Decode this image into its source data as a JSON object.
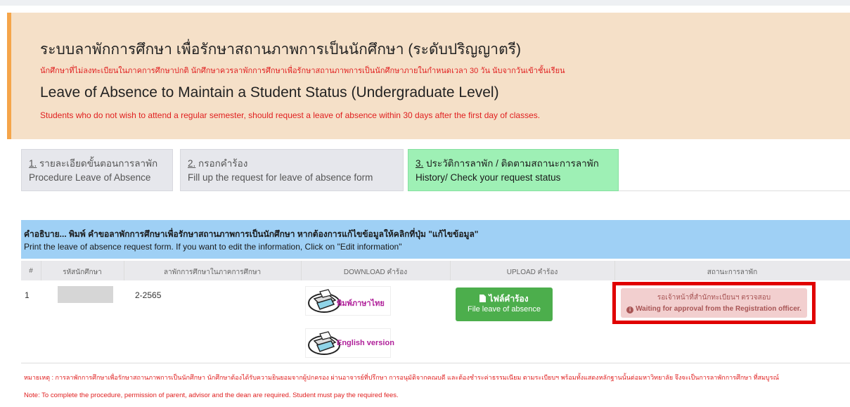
{
  "header": {
    "title_th": "ระบบลาพักการศึกษา เพื่อรักษาสถานภาพการเป็นนักศึกษา (ระดับปริญญาตรี)",
    "note_th": "นักศึกษาที่ไม่ลงทะเบียนในภาคการศึกษาปกติ นักศึกษาควรลาพักการศึกษาเพื่อรักษาสถานภาพการเป็นนักศึกษาภายในกำหนดเวลา 30 วัน นับจากวันเข้าชั้นเรียน",
    "title_en": "Leave of Absence to Maintain a Student Status (Undergraduate Level)",
    "note_en": "Students who do not wish to attend a regular semester, should request a leave of absence within 30 days after the first day of classes.",
    "accent_color": "#f5a54a",
    "background_color": "#f5e0c8"
  },
  "tabs": [
    {
      "number": "1.",
      "title_th": "รายละเอียดขั้นตอนการลาพัก",
      "title_en": "Procedure Leave of Absence",
      "active": false
    },
    {
      "number": "2.",
      "title_th": "กรอกคำร้อง",
      "title_en": "Fill up the request for leave of absence form",
      "active": false
    },
    {
      "number": "3.",
      "title_th": "ประวัติการลาพัก / ติดตามสถานะการลาพัก",
      "title_en": "History/ Check your request status",
      "active": true
    }
  ],
  "info": {
    "text_th": "คำอธิบาย... พิมพ์ คำขอลาพักการศึกษาเพื่อรักษาสถานภาพการเป็นนักศึกษา หากต้องการแก้ไขข้อมูลให้คลิกที่ปุ่ม \"แก้ไขข้อมูล\"",
    "text_en": "Print the leave of absence request form. If you want to edit the information, Click on \"Edit information\""
  },
  "table": {
    "headers": [
      "#",
      "รหัสนักศึกษา",
      "ลาพักการศึกษาในภาคการศึกษา",
      "DOWNLOAD คำร้อง",
      "UPLOAD คำร้อง",
      "สถานะการลาพัก"
    ],
    "rows": [
      {
        "no": "1",
        "student_id": "",
        "term": "2-2565",
        "download_th_label": "พิมพ์ภาษาไทย",
        "download_en_label": "English version",
        "upload_label_th": "ไฟล์คำร้อง",
        "upload_label_en": "File leave of absence",
        "status_th": "รอเจ้าหน้าที่สำนักทะเบียนฯ ตรวจสอบ",
        "status_en": "Waiting for approval from the Registration officer."
      }
    ]
  },
  "remarks": {
    "th": "หมายเหตุ : การลาพักการศึกษาเพื่อรักษาสถานภาพการเป็นนักศึกษา นักศึกษาต้องได้รับความยินยอมจากผู้ปกครอง ผ่านอาจารย์ที่ปรึกษา การอนุมัติจากคณบดี และต้องชำระค่าธรรมเนียม ตามระเบียบฯ พร้อมทั้งแสดงหลักฐานนั้นต่อมหาวิทยาลัย จึงจะเป็นการลาพักการศึกษา ที่สมบูรณ์",
    "en": "Note: To complete the procedure, permission of parent, advisor and the dean are required. Student must pay the required fees."
  },
  "icons": {
    "upload_icon": "file-icon",
    "status_icon": "info-circle-icon",
    "download_icon": "printer-icon"
  }
}
